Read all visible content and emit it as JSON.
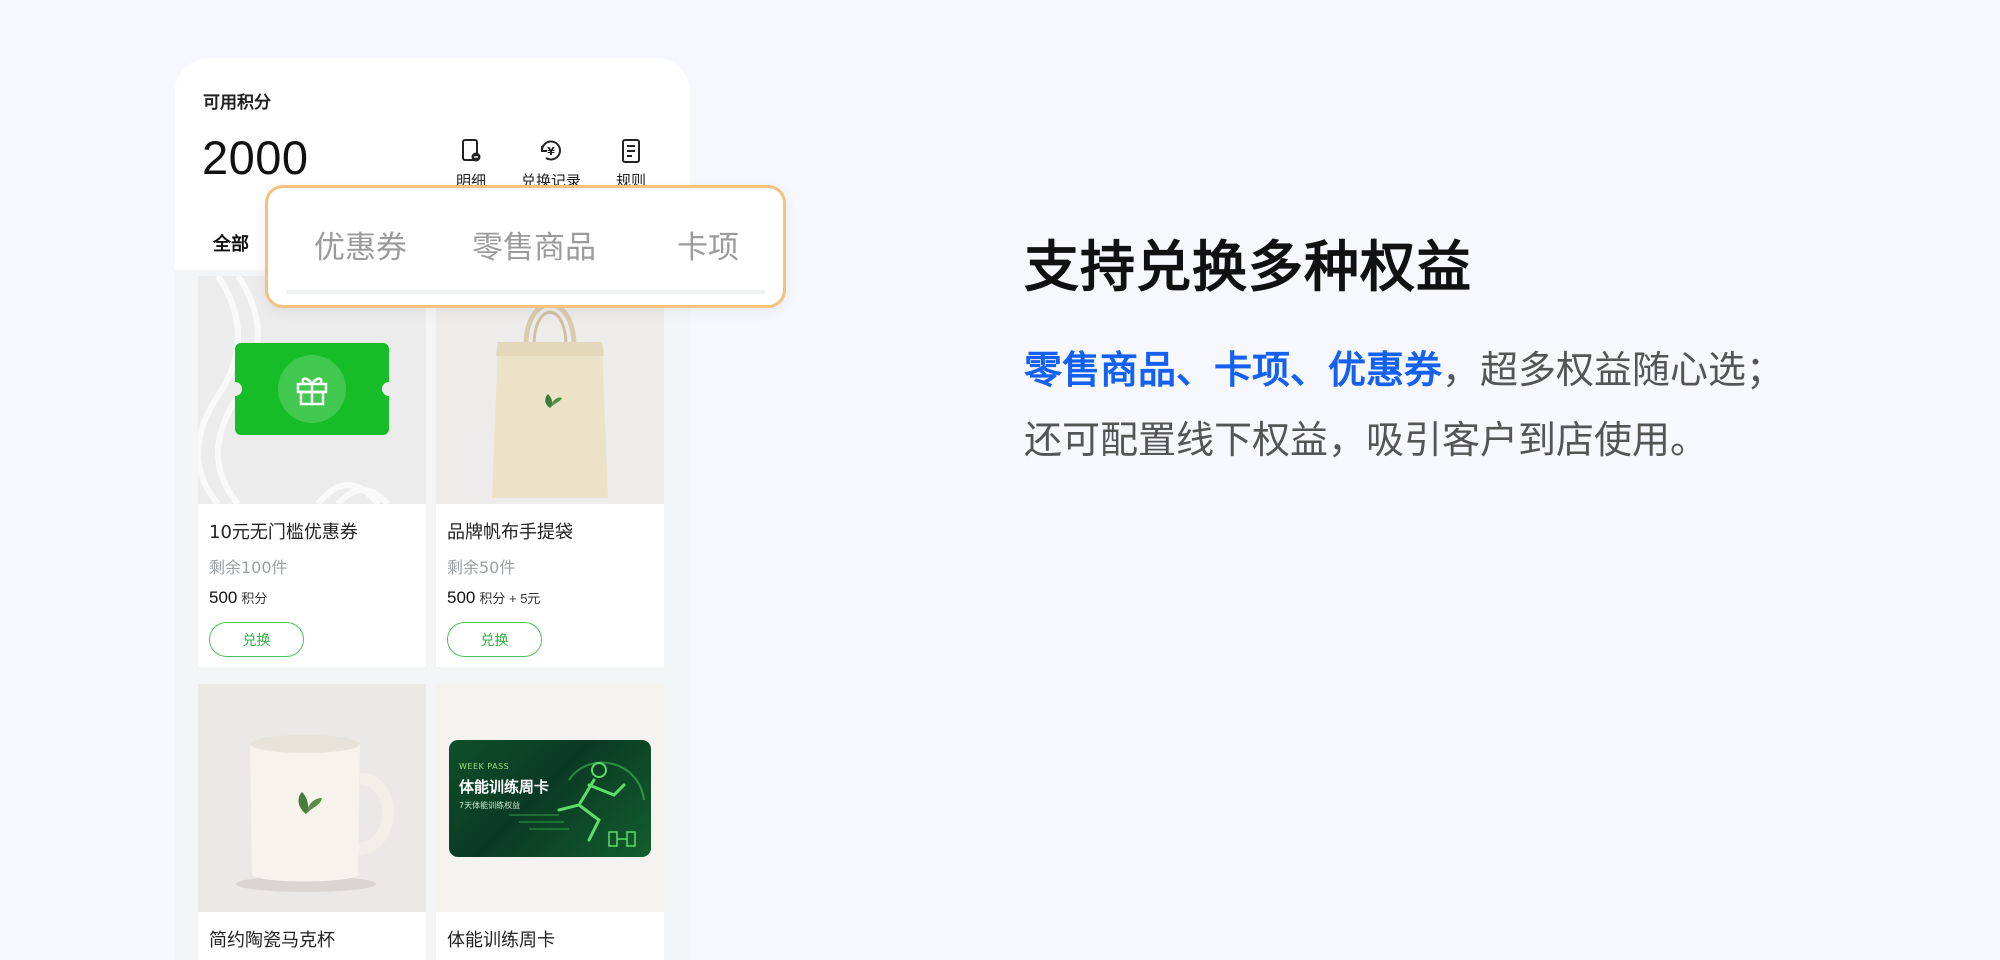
{
  "points": {
    "label": "可用积分",
    "value": "2000"
  },
  "quick_actions": [
    {
      "label": "明细",
      "icon": "detail-icon"
    },
    {
      "label": "兑换记录",
      "icon": "exchange-record-icon"
    },
    {
      "label": "规则",
      "icon": "rules-icon"
    }
  ],
  "tabs": {
    "all": "全部",
    "coupon": "优惠券",
    "retail": "零售商品",
    "card": "卡项"
  },
  "products": [
    {
      "name": "10元无门槛优惠券",
      "stock": "剩余100件",
      "price": "500",
      "unit": "积分",
      "button": "兑换",
      "image": "coupon-image"
    },
    {
      "name": "品牌帆布手提袋",
      "stock": "剩余50件",
      "price": "500",
      "unit": "积分 + 5元",
      "button": "兑换",
      "image": "tote-bag-image"
    },
    {
      "name": "简约陶瓷马克杯",
      "image": "mug-image"
    },
    {
      "name": "体能训练周卡",
      "image": "week-pass-image"
    }
  ],
  "week_pass": {
    "kicker": "WEEK PASS",
    "title": "体能训练周卡",
    "subtitle": "7天体能训练权益"
  },
  "headline": "支持兑换多种权益",
  "description": {
    "highlight": "零售商品、卡项、优惠券",
    "line1_rest": "，超多权益随心选；",
    "line2": "还可配置线下权益，吸引客户到店使用。"
  },
  "colors": {
    "accent_blue": "#1460f0",
    "brand_green": "#16bd28",
    "highlight_border": "#f2c27e"
  }
}
